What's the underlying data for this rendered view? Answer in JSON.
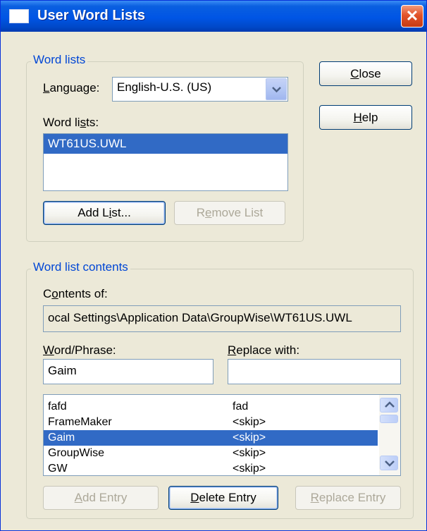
{
  "window": {
    "title": "User Word Lists",
    "close_glyph": "✕"
  },
  "word_lists_group": {
    "legend": "Word lists",
    "language_label_prefix": "L",
    "language_label_rest": "anguage:",
    "language_value": "English-U.S. (US)",
    "word_lists_label_a": "Word li",
    "word_lists_label_u": "s",
    "word_lists_label_b": "ts:",
    "lists": [
      "WT61US.UWL"
    ],
    "selected_list": "WT61US.UWL",
    "add_list_a": "Add L",
    "add_list_u": "i",
    "add_list_b": "st...",
    "remove_list_a": "R",
    "remove_list_u": "e",
    "remove_list_b": "move List"
  },
  "side_buttons": {
    "close_u": "C",
    "close_rest": "lose",
    "help_u": "H",
    "help_rest": "elp"
  },
  "contents_group": {
    "legend": "Word list contents",
    "contents_of_a": "C",
    "contents_of_u": "o",
    "contents_of_b": "ntents of:",
    "path": "ocal Settings\\Application Data\\GroupWise\\WT61US.UWL",
    "word_phrase_u": "W",
    "word_phrase_rest": "ord/Phrase:",
    "replace_with_u": "R",
    "replace_with_rest": "eplace with:",
    "word_value": "Gaim",
    "replace_value": "",
    "entries": [
      {
        "word": "fafd",
        "replacement": "fad"
      },
      {
        "word": "FrameMaker",
        "replacement": "<skip>"
      },
      {
        "word": "Gaim",
        "replacement": "<skip>"
      },
      {
        "word": "GroupWise",
        "replacement": "<skip>"
      },
      {
        "word": "GW",
        "replacement": "<skip>"
      }
    ],
    "selected_entry": "Gaim",
    "add_entry_u": "A",
    "add_entry_rest": "dd Entry",
    "delete_entry_u": "D",
    "delete_entry_rest": "elete Entry",
    "replace_entry_u": "R",
    "replace_entry_rest": "eplace Entry"
  },
  "colors": {
    "title_blue": "#0055e5",
    "selection": "#316ac5",
    "group_legend": "#0046d5",
    "dialog_bg": "#ece9d8"
  }
}
